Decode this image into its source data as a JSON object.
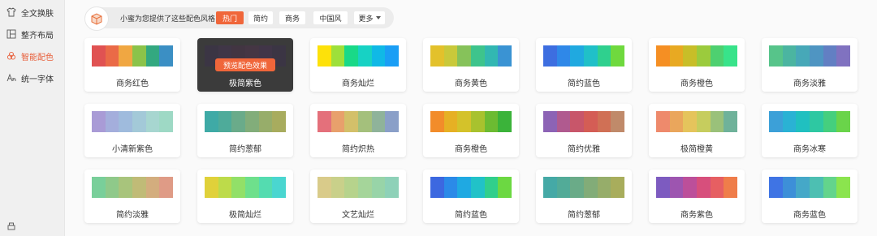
{
  "sidebar": {
    "items": [
      {
        "label": "全文换肤",
        "icon": "shirt-icon"
      },
      {
        "label": "整齐布局",
        "icon": "layout-icon"
      },
      {
        "label": "智能配色",
        "icon": "palette-icon",
        "active": true
      },
      {
        "label": "统一字体",
        "icon": "font-icon"
      }
    ],
    "bottom_icon": "printer-icon"
  },
  "toolbar": {
    "logo_icon": "box-logo-icon",
    "intro_text": "小蜜为您提供了这些配色风格：",
    "filters": [
      "热门",
      "简约",
      "商务",
      "中国风"
    ],
    "active_filter": "热门",
    "more_label": "更多"
  },
  "accent_color": "#f0663a",
  "cards": [
    {
      "name": "商务红色",
      "colors": [
        "#e05252",
        "#ea6a47",
        "#f0a742",
        "#8bc34a",
        "#33a880",
        "#3b8fc4"
      ]
    },
    {
      "name": "极简紫色",
      "colors": [
        "#3d2a56",
        "#4a2f5e",
        "#4f2b4f",
        "#5a2d55",
        "#4d2a60",
        "#3b2a55"
      ],
      "hover": true,
      "button": "预览配色效果"
    },
    {
      "name": "商务灿烂",
      "colors": [
        "#fde10a",
        "#9ee03a",
        "#19d988",
        "#17d2c4",
        "#10b9e6",
        "#1a9ef5"
      ]
    },
    {
      "name": "商务黄色",
      "colors": [
        "#e3c12b",
        "#c9c93a",
        "#86c25a",
        "#3ec48c",
        "#32b7b2",
        "#3a93d3"
      ]
    },
    {
      "name": "简约蓝色",
      "colors": [
        "#3d6ee0",
        "#2f88e8",
        "#20a9e0",
        "#20c0c8",
        "#2fd08e",
        "#6fd93e"
      ]
    },
    {
      "name": "商务橙色",
      "colors": [
        "#f58f23",
        "#e8a922",
        "#c8be28",
        "#9bcb3d",
        "#4ed070",
        "#38e38a"
      ]
    },
    {
      "name": "商务淡雅",
      "colors": [
        "#57c48a",
        "#4bb5a1",
        "#47a8b8",
        "#4f95c2",
        "#627fc3",
        "#8072c0"
      ]
    },
    {
      "name": "小清新紫色",
      "colors": [
        "#a99bd6",
        "#a4aedc",
        "#9fbbdd",
        "#a3c9d8",
        "#a7d6d0",
        "#9ed9c5"
      ]
    },
    {
      "name": "简约葱郁",
      "colors": [
        "#3faaa6",
        "#4eab9a",
        "#6aab8a",
        "#82ad7a",
        "#97ad6a",
        "#a8ac5e"
      ]
    },
    {
      "name": "简约炽热",
      "colors": [
        "#e4707b",
        "#e8a06c",
        "#d3c06a",
        "#a4c07c",
        "#8fb39a",
        "#8a9fc8"
      ]
    },
    {
      "name": "商务橙色",
      "colors": [
        "#f28c2a",
        "#e6b024",
        "#d4c22a",
        "#a8c22e",
        "#6cbb32",
        "#3bb33a"
      ]
    },
    {
      "name": "简约优雅",
      "colors": [
        "#8c63b5",
        "#b05a8f",
        "#c8566a",
        "#d45d55",
        "#d07055",
        "#c08a6a"
      ]
    },
    {
      "name": "极简橙黄",
      "colors": [
        "#ee8a6c",
        "#eaa65c",
        "#e5c45c",
        "#c6cd5e",
        "#9ac17a",
        "#6fb29a"
      ]
    },
    {
      "name": "商务冰寒",
      "colors": [
        "#3ca0d8",
        "#2ab2d4",
        "#20c0c0",
        "#2ec8a2",
        "#45cf7e",
        "#6ad44a"
      ]
    },
    {
      "name": "简约淡雅",
      "colors": [
        "#79cf9a",
        "#8fc98a",
        "#a8c47c",
        "#c0bb77",
        "#d3ad7e",
        "#df9b86"
      ]
    },
    {
      "name": "极简灿烂",
      "colors": [
        "#e0d13a",
        "#bddb4a",
        "#92e068",
        "#6ee08c",
        "#54dcb0",
        "#4ad6d0"
      ]
    },
    {
      "name": "文艺灿烂",
      "colors": [
        "#d9cb8a",
        "#c9d08a",
        "#b6d38c",
        "#a5d59a",
        "#98d4a8",
        "#8ed1b8"
      ]
    },
    {
      "name": "简约蓝色",
      "colors": [
        "#3c68e0",
        "#2b8ae8",
        "#1fa9e2",
        "#21c2c8",
        "#31cf8c",
        "#6cd842"
      ]
    },
    {
      "name": "简约葱郁",
      "colors": [
        "#45a9a6",
        "#52ab98",
        "#6aab88",
        "#82ac78",
        "#96ad6a",
        "#a8ad5c"
      ]
    },
    {
      "name": "商务紫色",
      "colors": [
        "#7d5bc0",
        "#9d55b0",
        "#bc4f9a",
        "#d74f7c",
        "#e65f62",
        "#ef7d4a"
      ]
    },
    {
      "name": "商务蓝色",
      "colors": [
        "#3f74e4",
        "#3d8fd8",
        "#45a8c8",
        "#4dbfb2",
        "#63d48c",
        "#8be44e"
      ]
    }
  ]
}
